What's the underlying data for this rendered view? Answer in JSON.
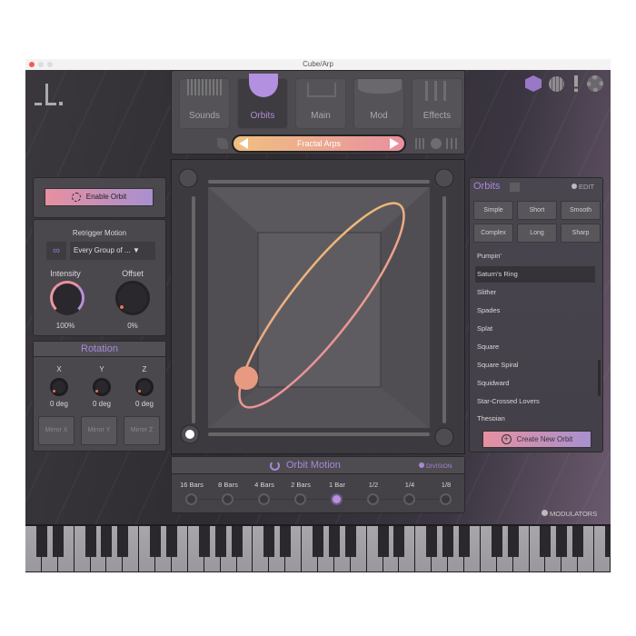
{
  "window": {
    "title": "Cube/Arp"
  },
  "logo": "L.",
  "tabs": [
    {
      "label": "Sounds"
    },
    {
      "label": "Orbits",
      "active": true
    },
    {
      "label": "Main"
    },
    {
      "label": "Mod"
    },
    {
      "label": "Effects"
    }
  ],
  "preset": {
    "name": "Fractal Arps"
  },
  "top_icons": [
    "cube-icon",
    "globe-icon",
    "alert-icon",
    "gear-icon"
  ],
  "left": {
    "enable_label": "Enable Orbit",
    "retrigger_label": "Retrigger Motion",
    "retrigger_value": "Every Group of ...",
    "intensity_label": "Intensity",
    "intensity_value": "100%",
    "intensity_level": 1.0,
    "offset_label": "Offset",
    "offset_value": "0%",
    "offset_level": 0
  },
  "rotation": {
    "title": "Rotation",
    "axes": [
      {
        "label": "X",
        "value": "0 deg"
      },
      {
        "label": "Y",
        "value": "0 deg"
      },
      {
        "label": "Z",
        "value": "0 deg"
      }
    ],
    "mirrors": [
      "Mirror X",
      "Mirror Y",
      "Mirror Z"
    ]
  },
  "orbits": {
    "title": "Orbits",
    "edit_label": "EDIT",
    "filters": [
      "Simple",
      "Short",
      "Smooth",
      "Complex",
      "Long",
      "Sharp"
    ],
    "items": [
      "Pumpin'",
      "Saturn's Ring",
      "Slither",
      "Spades",
      "Splat",
      "Square",
      "Square Spiral",
      "Squidward",
      "Star-Crossed Lovers",
      "Thespian"
    ],
    "selected": "Saturn's Ring",
    "create_label": "Create New Orbit"
  },
  "motion": {
    "title": "Orbit Motion",
    "division_label": "DIVISION",
    "divisions": [
      "16 Bars",
      "8 Bars",
      "4 Bars",
      "2 Bars",
      "1 Bar",
      "1/2",
      "1/4",
      "1/8"
    ],
    "selected": "1 Bar"
  },
  "modulators_label": "MODULATORS",
  "colors": {
    "accent": "#b08ad8",
    "orbit_start": "#e88aa0",
    "orbit_end": "#f0c070",
    "preset_grad_start": "#f0c080",
    "preset_grad_end": "#e890a0"
  }
}
